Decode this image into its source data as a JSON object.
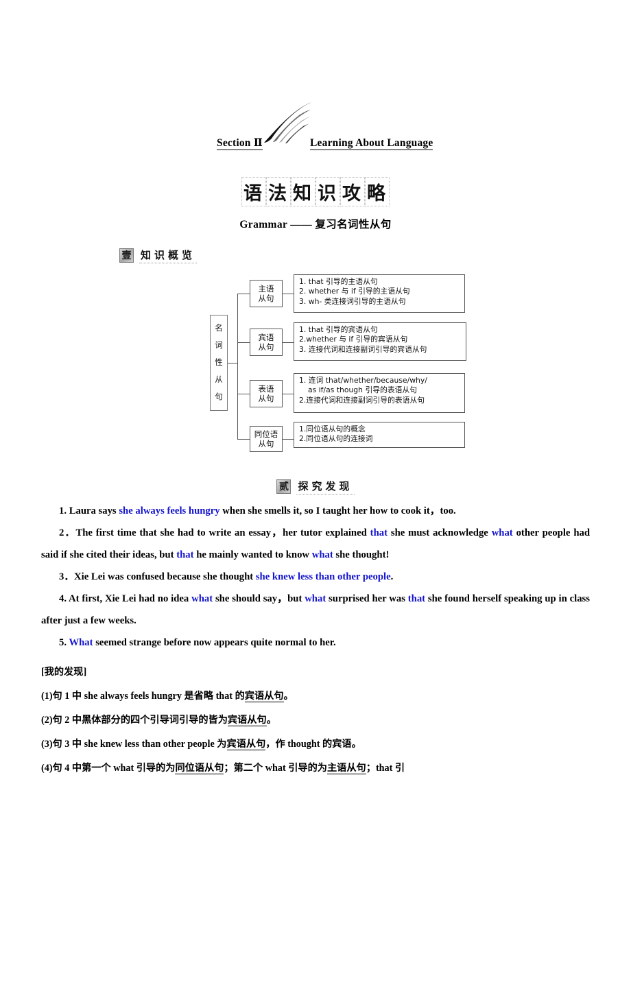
{
  "header": {
    "section_label": "Section Ⅱ",
    "section_title": "Learning About Language",
    "swoosh_icon": "comet-swoosh-icon"
  },
  "art_title": {
    "chars": [
      "语",
      "法",
      "知",
      "识",
      "攻",
      "略"
    ]
  },
  "grammar_line": "Grammar —— 复习名词性从句",
  "sub_headers": [
    {
      "badge": "壹",
      "title": "知识概览"
    },
    {
      "badge": "贰",
      "title": "探究发现"
    }
  ],
  "diagram": {
    "root": [
      "名",
      "词",
      "性",
      "从",
      "句"
    ],
    "branches": [
      {
        "category": "主语\n从句",
        "details": [
          "1. that 引导的主语从句",
          "2. whether 与 if 引导的主语从句",
          "3. wh- 类连接词引导的主语从句"
        ]
      },
      {
        "category": "宾语\n从句",
        "details": [
          "1. that 引导的宾语从句",
          "2.whether 与 if 引导的宾语从句",
          "3. 连接代词和连接副词引导的宾语从句"
        ]
      },
      {
        "category": "表语\n从句",
        "details": [
          "1. 连词 that/whether/because/why/",
          "as if/as though 引导的表语从句",
          "2.连接代词和连接副词引导的表语从句"
        ]
      },
      {
        "category": "同位语\n从句",
        "details": [
          "1.同位语从句的概念",
          "2.同位语从句的连接词"
        ]
      }
    ]
  },
  "sentences": [
    {
      "number": "1",
      "parts": [
        {
          "t": "1. Laura says ",
          "blue": false
        },
        {
          "t": "she always feels hungry",
          "blue": true
        },
        {
          "t": " when she smells it, so I taught her how to cook it，too.",
          "blue": false
        }
      ]
    },
    {
      "number": "2",
      "parts": [
        {
          "t": "2．The first time that she had to write an essay，her tutor explained ",
          "blue": false
        },
        {
          "t": "that",
          "blue": true
        },
        {
          "t": " she must acknowledge ",
          "blue": false
        },
        {
          "t": "what",
          "blue": true
        },
        {
          "t": " other people had said if she cited their ideas, but ",
          "blue": false
        },
        {
          "t": "that",
          "blue": true
        },
        {
          "t": " he mainly wanted to know ",
          "blue": false
        },
        {
          "t": "what",
          "blue": true
        },
        {
          "t": " she thought!",
          "blue": false
        }
      ]
    },
    {
      "number": "3",
      "parts": [
        {
          "t": "3．Xie Lei was confused because she thought ",
          "blue": false
        },
        {
          "t": "she knew less than other people",
          "blue": true
        },
        {
          "t": ".",
          "blue": false
        }
      ]
    },
    {
      "number": "4",
      "parts": [
        {
          "t": "4. At first, Xie Lei had no idea ",
          "blue": false
        },
        {
          "t": "what",
          "blue": true
        },
        {
          "t": " she should say，but ",
          "blue": false
        },
        {
          "t": "what",
          "blue": true
        },
        {
          "t": " surprised her was ",
          "blue": false
        },
        {
          "t": "that",
          "blue": true
        },
        {
          "t": " she found herself speaking up in class after just a few weeks.",
          "blue": false
        }
      ]
    },
    {
      "number": "5",
      "parts": [
        {
          "t": "5. ",
          "blue": false
        },
        {
          "t": "What",
          "blue": true
        },
        {
          "t": " seemed strange before now appears quite normal to her.",
          "blue": false
        }
      ]
    }
  ],
  "findings": {
    "heading": "[我的发现]",
    "items": [
      "(1)句 1 中  she always feels hungry 是省略 that 的宾语从句。",
      "(2)句 2 中黑体部分的四个引导词引导的皆为宾语从句。",
      "(3)句 3 中 she knew less than other people 为宾语从句，作 thought 的宾语。",
      "(4)句 4 中第一个 what 引导的为同位语从句；第二个 what 引导的为主语从句；that 引"
    ]
  }
}
